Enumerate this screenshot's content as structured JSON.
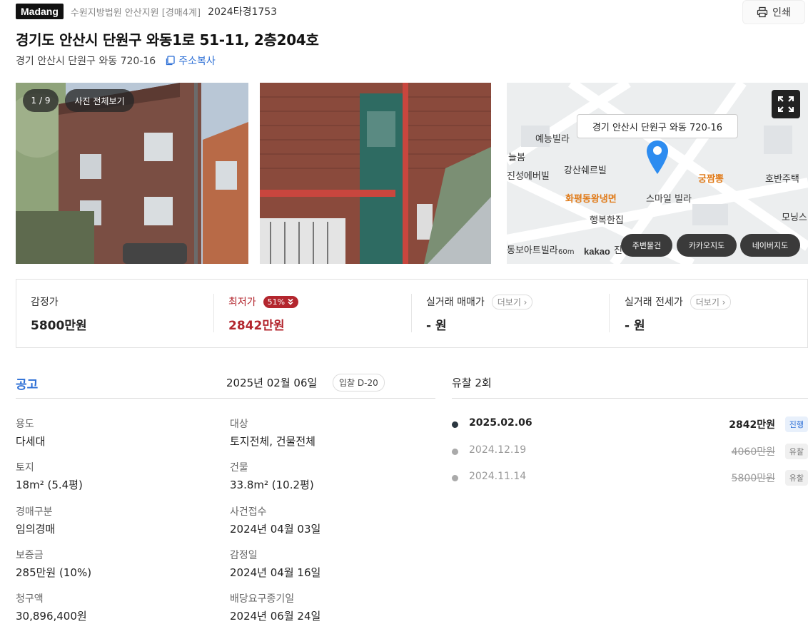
{
  "header": {
    "brand": "Madang",
    "court": "수원지방법원 안산지원 [경매4계]",
    "case_no": "2024타경1753",
    "print_label": "인쇄"
  },
  "property": {
    "title": "경기도 안산시 단원구 와동1로 51-11, 2층204호",
    "address": "경기 안산시 단원구 와동 720-16",
    "copy_label": "주소복사"
  },
  "gallery": {
    "counter": "1 / 9",
    "view_all": "사진 전체보기"
  },
  "map": {
    "callout": "경기 안산시 단원구 와동 720-16",
    "labels": [
      "예능빌라",
      "늘봄",
      "진성에버빌",
      "강산쉐르빌",
      "화평동왕냉면",
      "궁짬뽕",
      "스마일 빌라",
      "호반주택",
      "행복한집",
      "모닝스",
      "동보아트빌라",
      "진성"
    ],
    "scale": "60m",
    "logo": "kakao",
    "buttons": [
      "주변물건",
      "카카오지도",
      "네이버지도"
    ],
    "pin_color": "#2d8cf0"
  },
  "prices": {
    "appraisal_label": "감정가",
    "appraisal_value": "5800만원",
    "minimum_label": "최저가",
    "minimum_pct": "51%",
    "minimum_value": "2842만원",
    "sale_label": "실거래 매매가",
    "sale_value": "- 원",
    "jeonse_label": "실거래 전세가",
    "jeonse_value": "- 원",
    "more_label": "더보기",
    "accent_red": "#b3262e"
  },
  "notice": {
    "title": "공고",
    "date": "2025년 02월 06일",
    "dday": "입찰 D-20",
    "fields": [
      {
        "k": "용도",
        "v": "다세대"
      },
      {
        "k": "대상",
        "v": "토지전체, 건물전체"
      },
      {
        "k": "토지",
        "v": "18m² (5.4평)"
      },
      {
        "k": "건물",
        "v": "33.8m² (10.2평)"
      },
      {
        "k": "경매구분",
        "v": "임의경매"
      },
      {
        "k": "사건접수",
        "v": "2024년 04월 03일"
      },
      {
        "k": "보증금",
        "v": "285만원 (10%)"
      },
      {
        "k": "감정일",
        "v": "2024년 04월 16일"
      },
      {
        "k": "청구액",
        "v": "30,896,400원"
      },
      {
        "k": "배당요구종기일",
        "v": "2024년 06월 24일"
      }
    ]
  },
  "history": {
    "title": "유찰 2회",
    "rows": [
      {
        "date": "2025.02.06",
        "amount": "2842만원",
        "status": "진행"
      },
      {
        "date": "2024.12.19",
        "amount": "4060만원",
        "status": "유찰"
      },
      {
        "date": "2024.11.14",
        "amount": "5800만원",
        "status": "유찰"
      }
    ]
  }
}
